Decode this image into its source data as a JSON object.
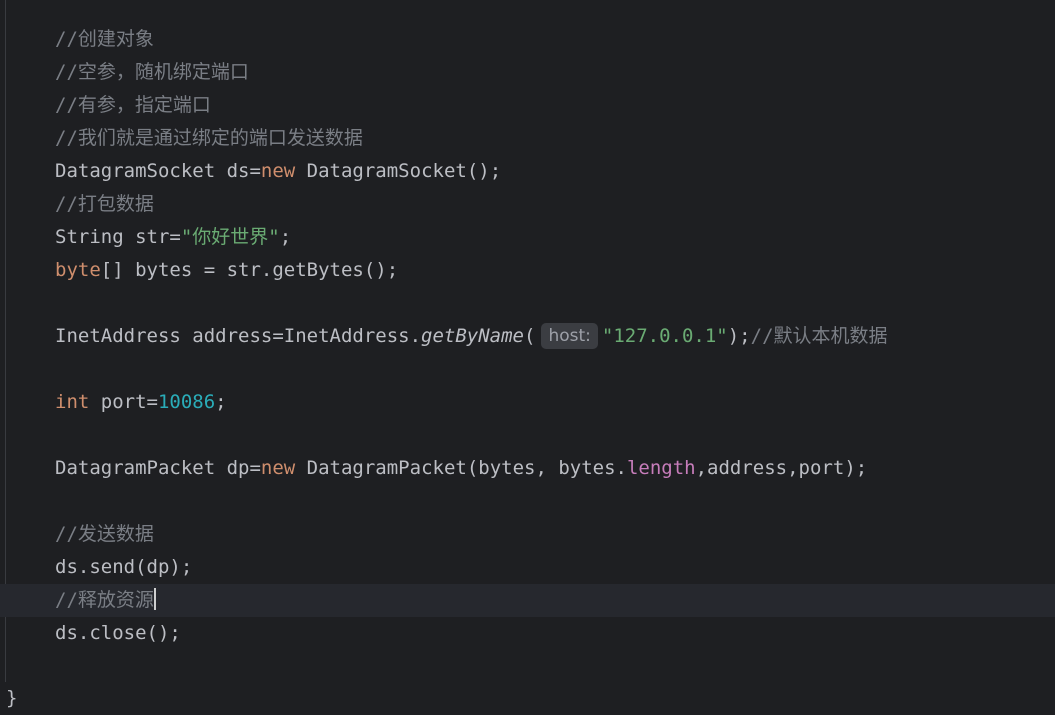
{
  "editor": {
    "lines": {
      "c1": "//创建对象",
      "c2": "//空参，随机绑定端口",
      "c3": "//有参，指定端口",
      "c4": "//我们就是通过绑定的端口发送数据",
      "socket": {
        "a": "DatagramSocket ds=",
        "kw": "new",
        "b": " DatagramSocket();"
      },
      "c5": "//打包数据",
      "str_decl": {
        "a": "String str=",
        "s": "\"你好世界\"",
        "b": ";"
      },
      "bytes_decl": {
        "kw": "byte",
        "b": "[] bytes = str.getBytes();"
      },
      "addr": {
        "a": "InetAddress address=InetAddress.",
        "m": "getByName",
        "p": "(",
        "hint": "host:",
        "s": "\"127.0.0.1\"",
        "b": ");",
        "c": "//默认本机数据"
      },
      "port": {
        "kw": "int",
        "a": " port=",
        "n": "10086",
        "b": ";"
      },
      "packet": {
        "a": "DatagramPacket dp=",
        "kw": "new",
        "b": " DatagramPacket(bytes, bytes.",
        "f": "length",
        "c": ",address,port);"
      },
      "c6": "//发送数据",
      "send": "ds.send(dp);",
      "c7": "//释放资源",
      "close": "ds.close();",
      "brace": "}"
    }
  }
}
